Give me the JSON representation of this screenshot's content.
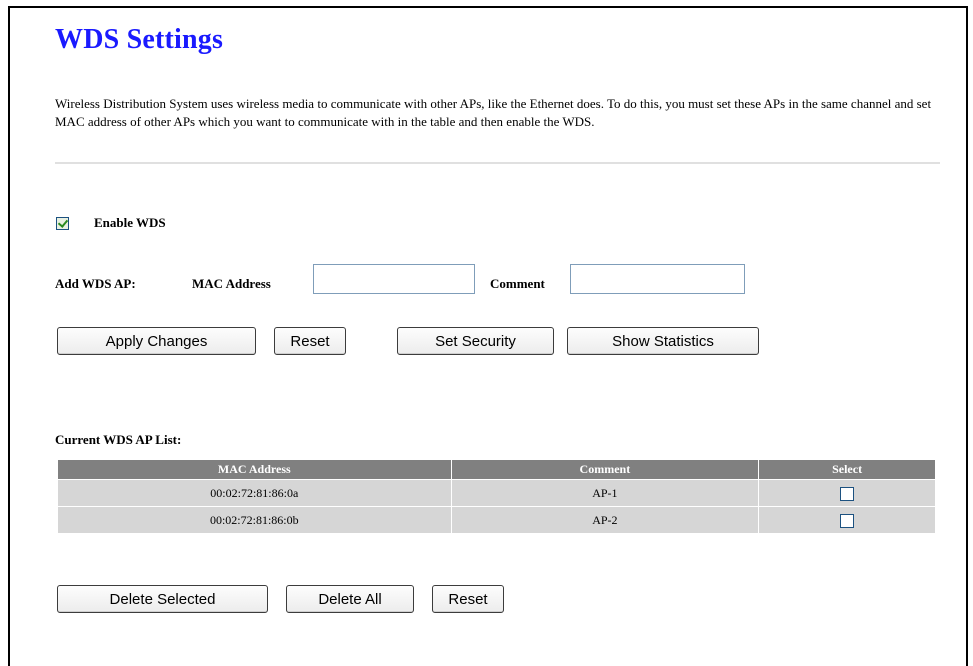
{
  "page": {
    "title": "WDS Settings",
    "description": "Wireless Distribution System uses wireless media to communicate with other APs, like the Ethernet does. To do this, you must set these APs in the same channel and set MAC address of other APs which you want to communicate with in the table and then enable the WDS."
  },
  "enable_wds": {
    "label": "Enable WDS",
    "checked": true
  },
  "add_ap": {
    "label": "Add WDS AP:",
    "mac_label": "MAC Address",
    "mac_value": "",
    "comment_label": "Comment",
    "comment_value": ""
  },
  "buttons": {
    "apply": "Apply Changes",
    "reset": "Reset",
    "set_security": "Set Security",
    "show_statistics": "Show Statistics",
    "delete_selected": "Delete Selected",
    "delete_all": "Delete All",
    "reset2": "Reset"
  },
  "ap_list": {
    "label": "Current WDS AP List:",
    "columns": [
      "MAC Address",
      "Comment",
      "Select"
    ],
    "rows": [
      {
        "mac": "00:02:72:81:86:0a",
        "comment": "AP-1",
        "selected": false
      },
      {
        "mac": "00:02:72:81:86:0b",
        "comment": "AP-2",
        "selected": false
      }
    ]
  },
  "colors": {
    "title": "#1a1aff",
    "table_header": "#808080",
    "table_row": "#d6d6d6"
  }
}
